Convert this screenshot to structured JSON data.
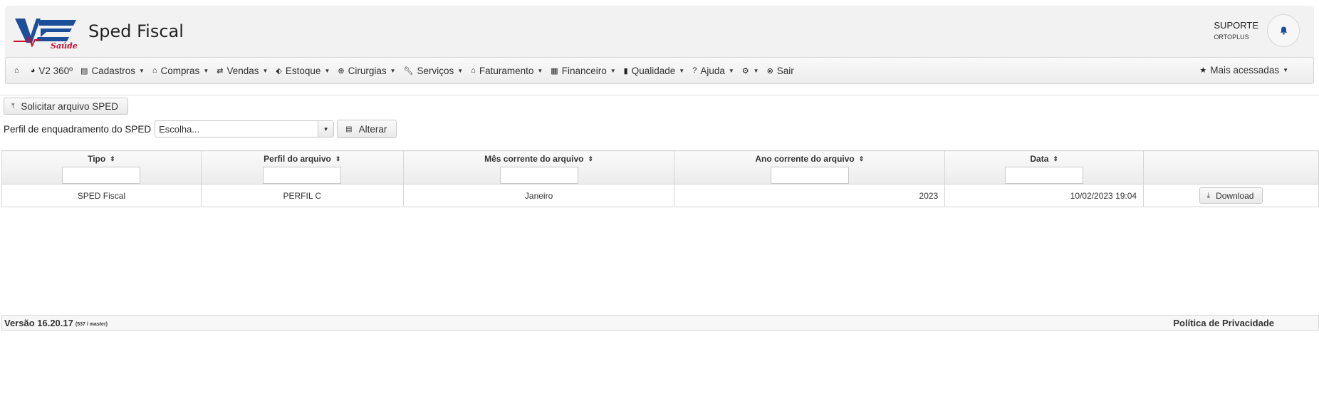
{
  "header": {
    "app_title": "Sped Fiscal",
    "logo_text": "V2 Saúde",
    "user": {
      "name": "SUPORTE",
      "company": "ORTOPLUS"
    }
  },
  "nav": {
    "items": [
      {
        "label": "",
        "icon": "home-icon",
        "caret": false
      },
      {
        "label": "V2 360º",
        "icon": "pie-chart-icon",
        "caret": false
      },
      {
        "label": "Cadastros",
        "icon": "save-icon",
        "caret": true
      },
      {
        "label": "Compras",
        "icon": "bank-icon",
        "caret": true
      },
      {
        "label": "Vendas",
        "icon": "transfer-icon",
        "caret": true
      },
      {
        "label": "Estoque",
        "icon": "tag-icon",
        "caret": true
      },
      {
        "label": "Cirurgias",
        "icon": "plus-circle-icon",
        "caret": true
      },
      {
        "label": "Serviços",
        "icon": "wrench-icon",
        "caret": true
      },
      {
        "label": "Faturamento",
        "icon": "bank-icon",
        "caret": true
      },
      {
        "label": "Financeiro",
        "icon": "calculator-icon",
        "caret": true
      },
      {
        "label": "Qualidade",
        "icon": "book-icon",
        "caret": true
      },
      {
        "label": "Ajuda",
        "icon": "question-icon",
        "caret": true
      },
      {
        "label": "",
        "icon": "gear-icon",
        "caret": true
      },
      {
        "label": "Sair",
        "icon": "close-circle-icon",
        "caret": false
      }
    ],
    "most_accessed": "Mais acessadas"
  },
  "toolbar": {
    "request_label": "Solicitar arquivo SPED",
    "profile_label": "Perfil de enquadramento do SPED",
    "profile_value": "Escolha...",
    "change_label": "Alterar"
  },
  "table": {
    "columns": [
      "Tipo",
      "Perfil do arquivo",
      "Mês corrente do arquivo",
      "Ano corrente do arquivo",
      "Data",
      ""
    ],
    "rows": [
      {
        "tipo": "SPED Fiscal",
        "perfil": "PERFIL C",
        "mes": "Janeiro",
        "ano": "2023",
        "data": "10/02/2023 19:04",
        "action": "Download"
      }
    ]
  },
  "footer": {
    "version": "Versão 16.20.17",
    "build": "(537 / master)",
    "privacy": "Política de Privacidade"
  }
}
